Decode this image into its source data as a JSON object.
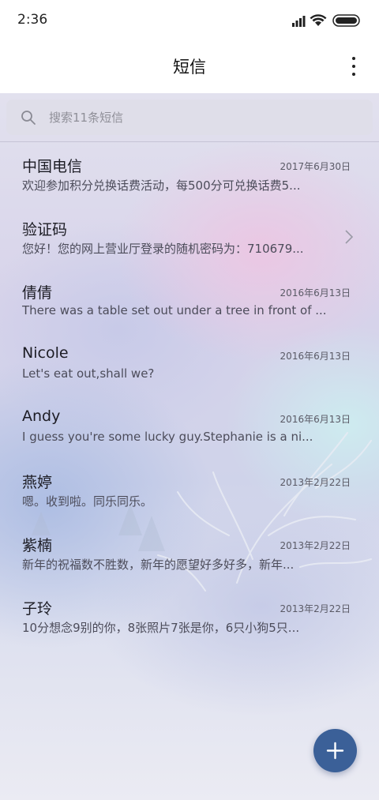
{
  "status_bar": {
    "time": "2:36",
    "icons": [
      "signal-icon",
      "wifi-icon",
      "battery-icon"
    ]
  },
  "header": {
    "title": "短信",
    "menu_icon": "more-vertical-icon"
  },
  "search": {
    "placeholder": "搜索11条短信",
    "icon": "search-icon"
  },
  "messages": [
    {
      "sender": "中国电信",
      "date": "2017年6月30日",
      "preview": "欢迎参加积分兑换话费活动，每500分可兑换话费5..."
    },
    {
      "sender": "验证码",
      "date": "",
      "preview": "您好！您的网上营业厅登录的随机密码为：710679...",
      "chevron": "chevron-right-icon"
    },
    {
      "sender": "倩倩",
      "date": "2016年6月13日",
      "preview": "There was a table set out under a tree in front of ..."
    },
    {
      "sender": "Nicole",
      "date": "2016年6月13日",
      "preview": "Let's eat out,shall we?"
    },
    {
      "sender": "Andy",
      "date": "2016年6月13日",
      "preview": "I guess you're some lucky guy.Stephanie is a ni..."
    },
    {
      "sender": "燕婷",
      "date": "2013年2月22日",
      "preview": "嗯。收到啦。同乐同乐。"
    },
    {
      "sender": "紫楠",
      "date": "2013年2月22日",
      "preview": "新年的祝福数不胜数，新年的愿望好多好多，新年..."
    },
    {
      "sender": "子玲",
      "date": "2013年2月22日",
      "preview": "10分想念9别的你，8张照片7张是你，6只小狗5只..."
    }
  ],
  "fab": {
    "icon": "plus-icon"
  },
  "colors": {
    "accent": "#3b6098",
    "header_bg": "#ffffff",
    "title_text": "#111111",
    "secondary_text": "#4c4c5a"
  }
}
